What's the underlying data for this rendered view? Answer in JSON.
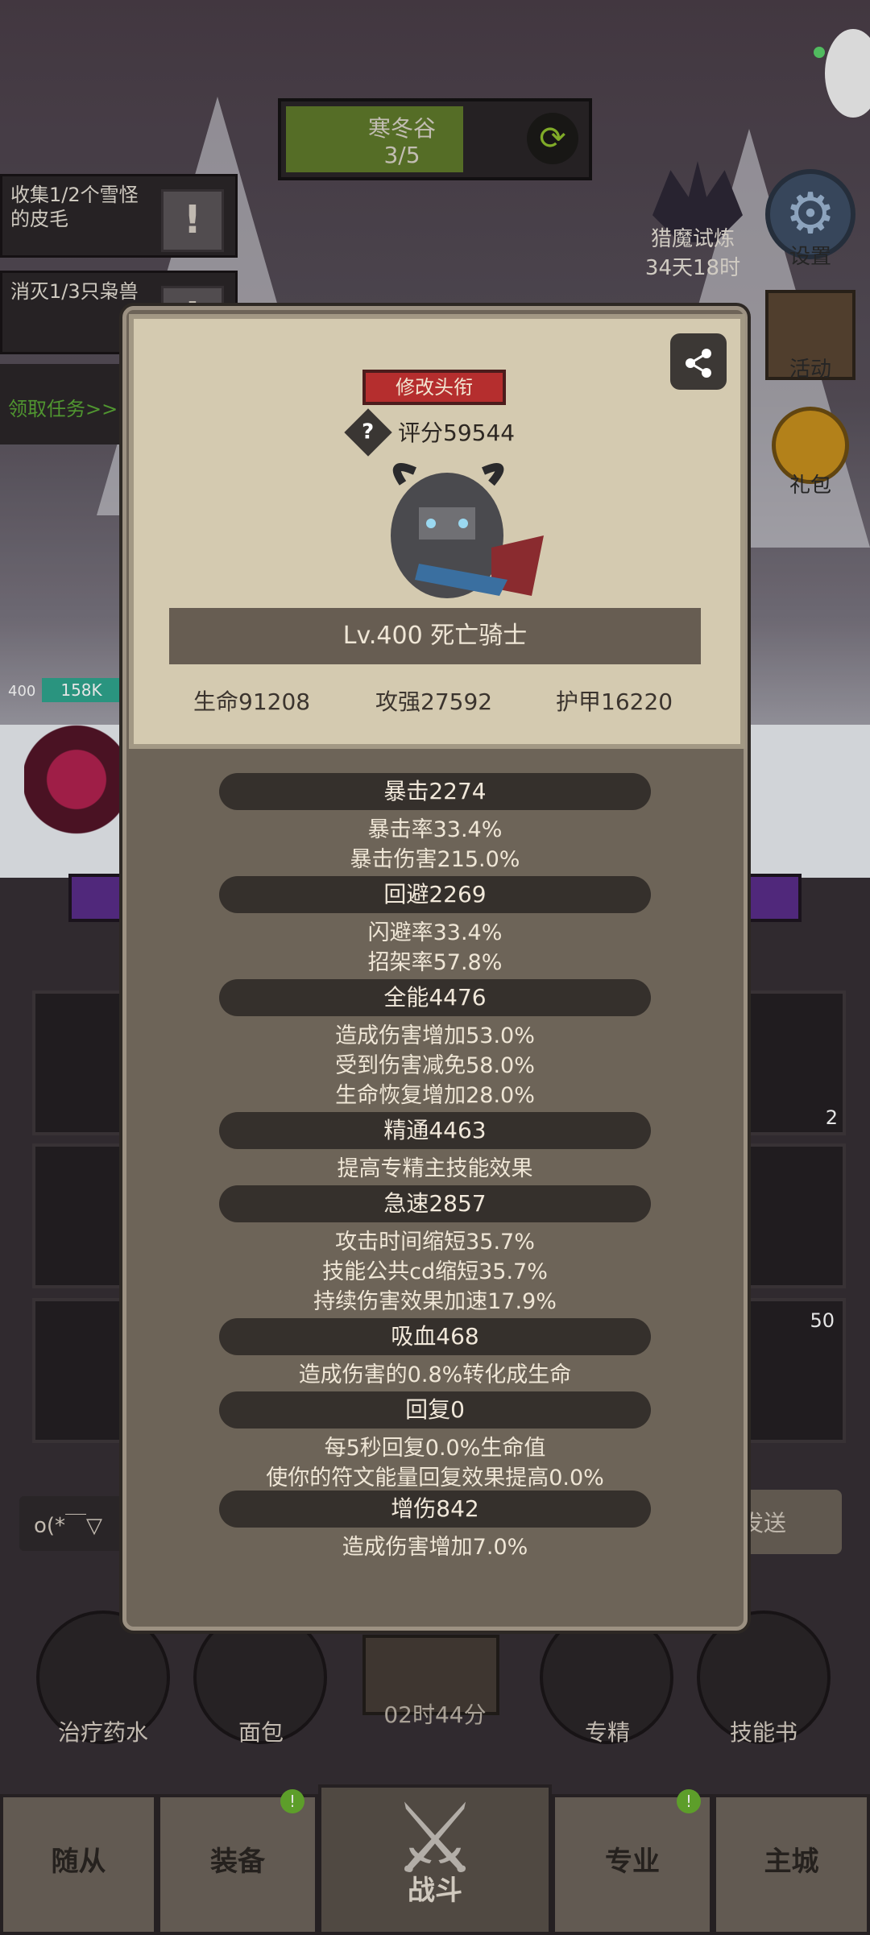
{
  "top_bar": {
    "location": "寒冬谷",
    "progress": "3/5",
    "progress_fraction": 0.6
  },
  "quests": [
    {
      "text": "收集1/2个雪怪的皮毛"
    },
    {
      "text": "消灭1/3只枭兽"
    }
  ],
  "quest_link": "领取任务>>",
  "side": {
    "event_label": "猎魔试炼",
    "event_timer": "34天18时",
    "settings": "设置",
    "activity": "活动",
    "gift": "礼包"
  },
  "player": {
    "level": "400",
    "hp": "158K"
  },
  "chat": {
    "text": "o(*￣▽",
    "send": "发送"
  },
  "slots": {
    "badge_a": "2",
    "badge_b": "50"
  },
  "quick_items": [
    "治疗药水",
    "面包",
    "专精",
    "技能书"
  ],
  "timer": "02时44分",
  "nav": {
    "items": [
      "随从",
      "装备",
      "战斗",
      "专业",
      "主城"
    ],
    "dot": "!"
  },
  "card": {
    "title_button": "修改头衔",
    "score": "评分59544",
    "name": "Lv.400 死亡骑士",
    "hp": "生命91208",
    "attack": "攻强27592",
    "armor": "护甲16220"
  },
  "stats": [
    {
      "head": "暴击2274",
      "lines": [
        "暴击率33.4%",
        "暴击伤害215.0%"
      ]
    },
    {
      "head": "回避2269",
      "lines": [
        "闪避率33.4%",
        "招架率57.8%"
      ]
    },
    {
      "head": "全能4476",
      "lines": [
        "造成伤害增加53.0%",
        "受到伤害减免58.0%",
        "生命恢复增加28.0%"
      ]
    },
    {
      "head": "精通4463",
      "lines": [
        "提高专精主技能效果"
      ]
    },
    {
      "head": "急速2857",
      "lines": [
        "攻击时间缩短35.7%",
        "技能公共cd缩短35.7%",
        "持续伤害效果加速17.9%"
      ]
    },
    {
      "head": "吸血468",
      "lines": [
        "造成伤害的0.8%转化成生命"
      ]
    },
    {
      "head": "回复0",
      "lines": [
        "每5秒回复0.0%生命值",
        "使你的符文能量回复效果提高0.0%"
      ]
    },
    {
      "head": "增伤842",
      "lines": [
        "造成伤害增加7.0%"
      ]
    }
  ]
}
